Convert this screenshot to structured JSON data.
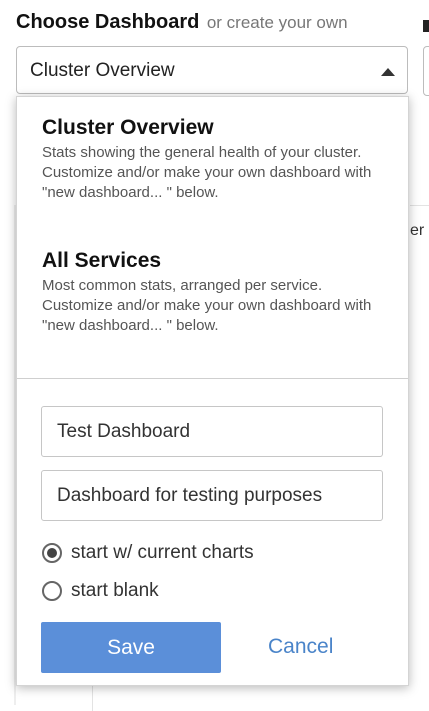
{
  "header": {
    "title": "Choose Dashboard",
    "subtitle": "or create your own"
  },
  "select": {
    "value": "Cluster Overview"
  },
  "options": [
    {
      "title": "Cluster Overview",
      "description": "Stats showing the general health of your cluster. Customize and/or make your own dashboard with \"new dashboard... \" below."
    },
    {
      "title": "All Services",
      "description": "Most common stats, arranged per service. Customize and/or make your own dashboard with \"new dashboard... \" below."
    }
  ],
  "form": {
    "name_value": "Test Dashboard",
    "description_value": "Dashboard for testing purposes",
    "radio_current": "start w/ current charts",
    "radio_blank": "start blank",
    "save_label": "Save",
    "cancel_label": "Cancel"
  },
  "background": {
    "partial_text": "er"
  },
  "colors": {
    "accent": "#5b8fd9",
    "link": "#4a84c9"
  },
  "icons": {
    "caret": "caret-up-icon"
  }
}
